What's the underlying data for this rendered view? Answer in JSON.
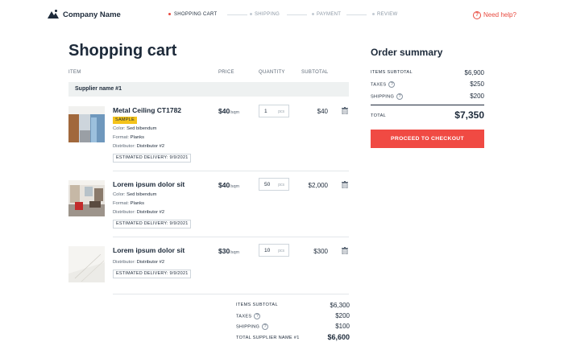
{
  "header": {
    "company_name": "Company Name",
    "steps": [
      {
        "label": "SHOPPING CART",
        "active": true
      },
      {
        "label": "SHIPPING",
        "active": false
      },
      {
        "label": "PAYMENT",
        "active": false
      },
      {
        "label": "REVIEW",
        "active": false
      }
    ],
    "help_label": "Need help?",
    "help_icon": "question-circle-icon"
  },
  "cart": {
    "title": "Shopping cart",
    "columns": {
      "item": "ITEM",
      "price": "PRICE",
      "quantity": "QUANTITY",
      "subtotal": "SUBTOTAL"
    },
    "supplier_name": "Supplier name #1",
    "items": [
      {
        "name": "Metal Ceiling CT1782",
        "badge": "SAMPLE",
        "attributes": [
          {
            "key": "Color:",
            "value": "Sed bibendum"
          },
          {
            "key": "Format:",
            "value": "Planks"
          },
          {
            "key": "Distributor:",
            "value": "Distributor #2"
          }
        ],
        "delivery": "ESTIMATED DELIVERY: 9/9/2021",
        "price": "$40",
        "price_unit": "/sqm",
        "quantity": "1",
        "quantity_unit": "pcs",
        "subtotal": "$40"
      },
      {
        "name": "Lorem ipsum dolor sit",
        "attributes": [
          {
            "key": "Color:",
            "value": "Sed bibendum"
          },
          {
            "key": "Format:",
            "value": "Planks"
          },
          {
            "key": "Distributor:",
            "value": "Distributor #2"
          }
        ],
        "delivery": "ESTIMATED DELIVERY: 9/9/2021",
        "price": "$40",
        "price_unit": "/sqm",
        "quantity": "50",
        "quantity_unit": "pcs",
        "subtotal": "$2,000"
      },
      {
        "name": "Lorem ipsum dolor sit",
        "attributes": [
          {
            "key": "Distributor:",
            "value": "Distributor #2"
          }
        ],
        "delivery": "ESTIMATED DELIVERY: 9/9/2021",
        "price": "$30",
        "price_unit": "/sqm",
        "quantity": "10",
        "quantity_unit": "pcs",
        "subtotal": "$300"
      }
    ],
    "supplier_summary": {
      "items_subtotal_label": "ITEMS SUBTOTAL",
      "items_subtotal": "$6,300",
      "taxes_label": "TAXES",
      "taxes": "$200",
      "shipping_label": "SHIPPING",
      "shipping": "$100",
      "total_label": "TOTAL SUPPLIER NAME #1",
      "total": "$6,600"
    }
  },
  "order_summary": {
    "title": "Order summary",
    "items_subtotal_label": "ITEMS SUBTOTAL",
    "items_subtotal": "$6,900",
    "taxes_label": "TAXES",
    "taxes": "$250",
    "shipping_label": "SHIPPING",
    "shipping": "$200",
    "total_label": "TOTAL",
    "total": "$7,350",
    "checkout_label": "PROCEED TO CHECKOUT"
  },
  "colors": {
    "accent": "#f04a43",
    "badge": "#f4c31a",
    "text": "#1d2a3a"
  }
}
